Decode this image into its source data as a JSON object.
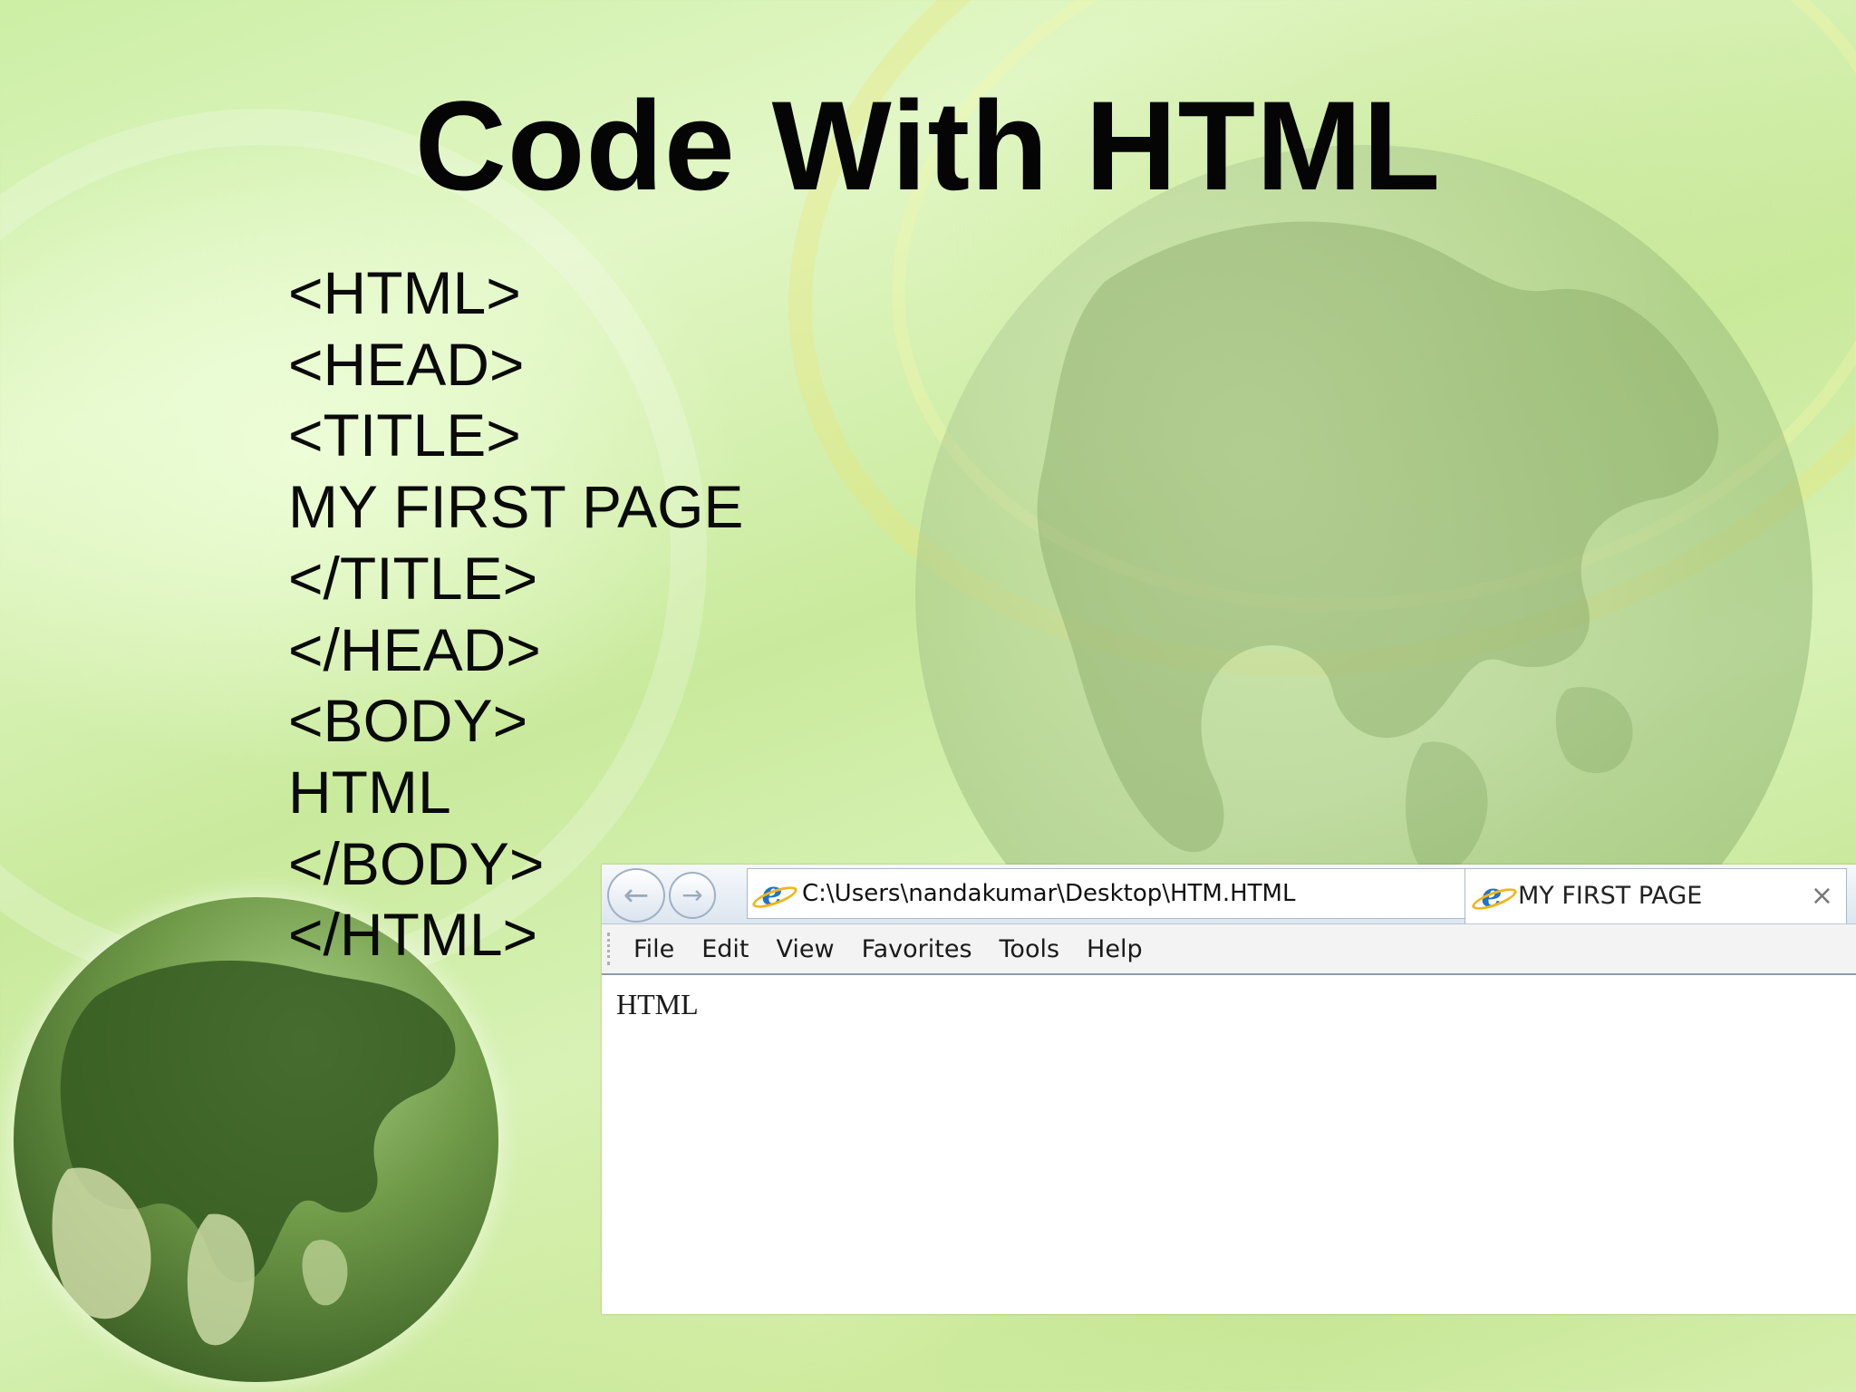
{
  "slide": {
    "title": "Code With HTML",
    "code_lines": [
      "<HTML>",
      "<HEAD>",
      "<TITLE>",
      "MY FIRST PAGE",
      "</TITLE>",
      "</HEAD>",
      "<BODY>",
      "HTML",
      "</BODY>",
      "</HTML>"
    ]
  },
  "browser": {
    "nav": {
      "back_icon": "back-arrow-icon",
      "forward_icon": "forward-arrow-icon",
      "back_glyph": "←",
      "forward_glyph": "→"
    },
    "address_bar": {
      "value": "C:\\Users\\nandakumar\\Desktop\\HTM.HTML",
      "search_glyph": "⌕",
      "dropdown_glyph": "▾",
      "refresh_glyph": "↻"
    },
    "tab": {
      "title": "MY FIRST PAGE",
      "close_glyph": "×"
    },
    "menu": [
      "File",
      "Edit",
      "View",
      "Favorites",
      "Tools",
      "Help"
    ],
    "content_text": "HTML",
    "ie_glyph": "e"
  },
  "colors": {
    "ie_blue": "#1f74c9",
    "ie_ring": "#f2b516"
  }
}
